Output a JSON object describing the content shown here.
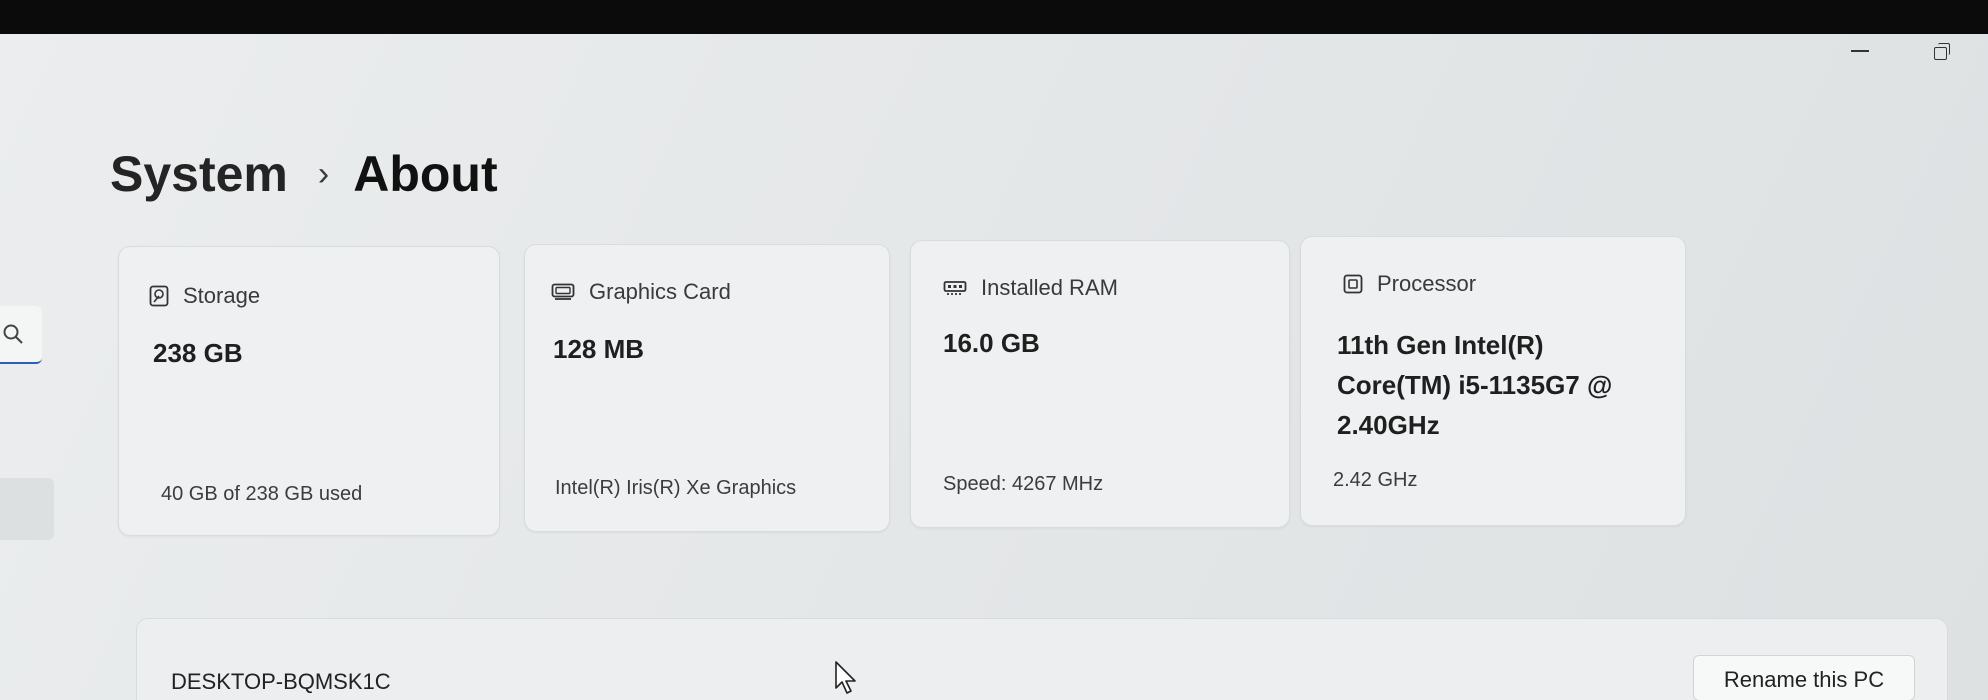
{
  "breadcrumb": {
    "parent": "System",
    "separator": "›",
    "current": "About"
  },
  "cards": {
    "storage": {
      "icon": "hard-drive-icon",
      "label": "Storage",
      "value": "238 GB",
      "detail": "40 GB of 238 GB used"
    },
    "graphics": {
      "icon": "graphics-card-icon",
      "label": "Graphics Card",
      "value": "128 MB",
      "detail": "Intel(R) Iris(R) Xe Graphics"
    },
    "ram": {
      "icon": "memory-icon",
      "label": "Installed RAM",
      "value": "16.0 GB",
      "detail": "Speed: 4267 MHz"
    },
    "processor": {
      "icon": "processor-icon",
      "label": "Processor",
      "value": "11th Gen Intel(R) Core(TM) i5-1135G7 @ 2.40GHz",
      "detail": "2.42 GHz"
    }
  },
  "device": {
    "name": "DESKTOP-BQMSK1C",
    "rename_label": "Rename this PC"
  },
  "colors": {
    "accent": "#2b5fb3",
    "card_bg": "#eef0f1"
  }
}
